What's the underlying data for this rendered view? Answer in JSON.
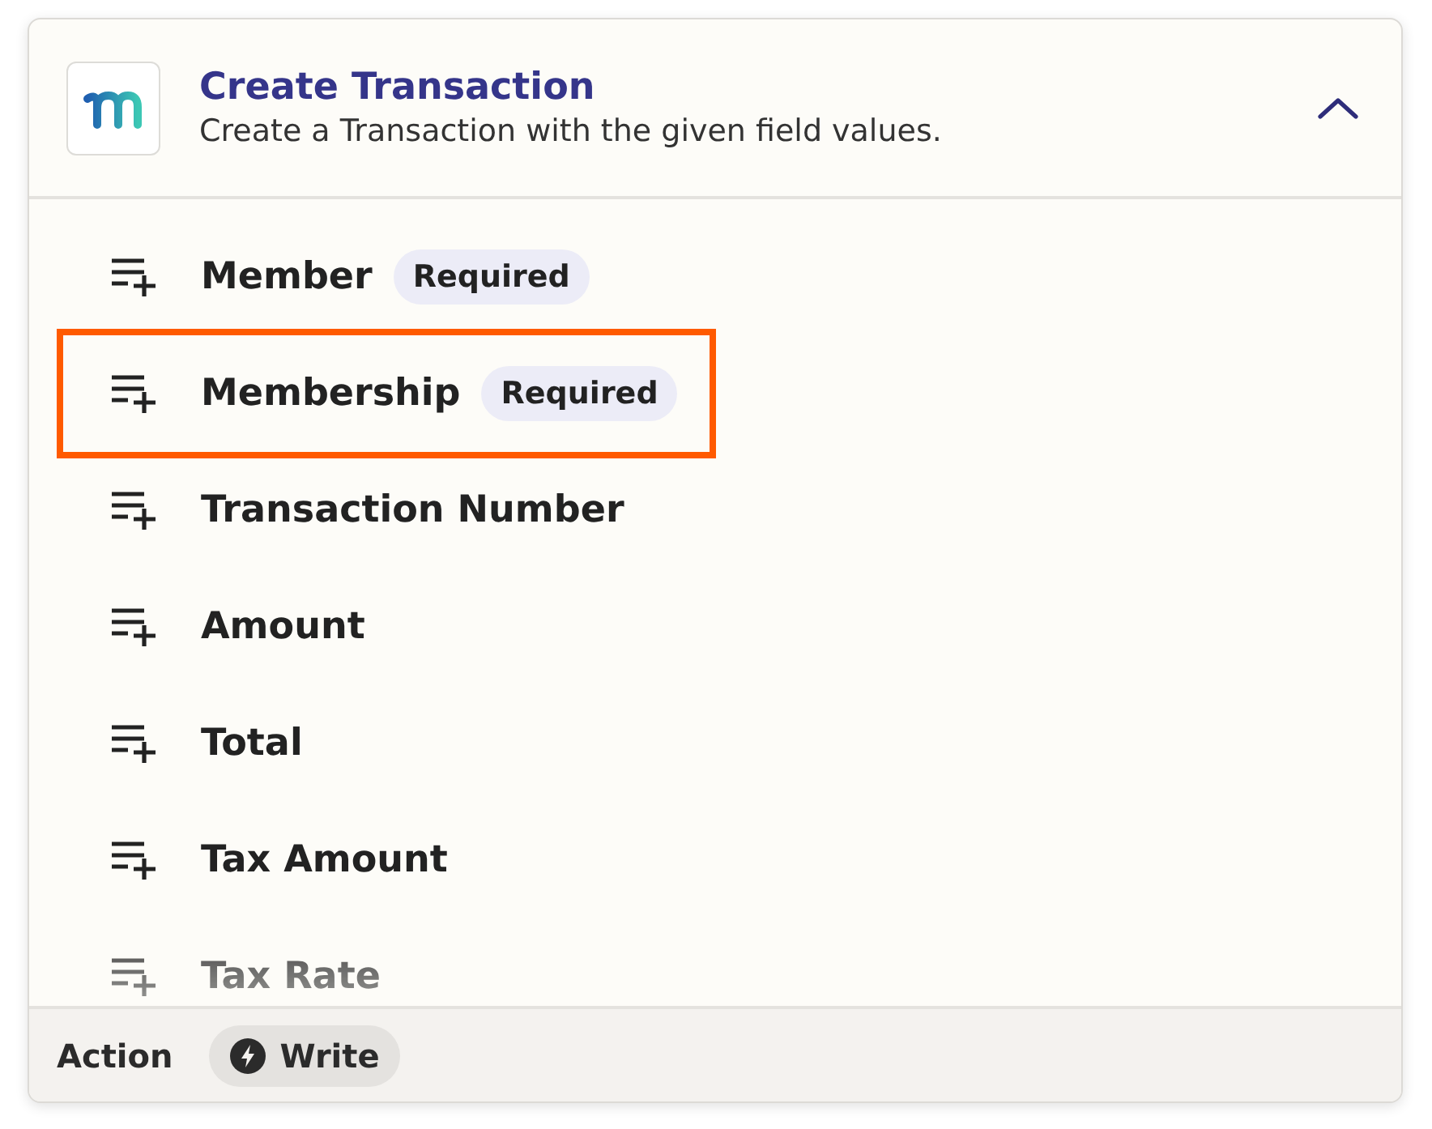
{
  "header": {
    "title": "Create Transaction",
    "description": "Create a Transaction with the given field values.",
    "expanded": true
  },
  "fields": [
    {
      "label": "Member",
      "required": true,
      "required_label": "Required",
      "highlighted": false
    },
    {
      "label": "Membership",
      "required": true,
      "required_label": "Required",
      "highlighted": true
    },
    {
      "label": "Transaction Number",
      "required": false,
      "highlighted": false
    },
    {
      "label": "Amount",
      "required": false,
      "highlighted": false
    },
    {
      "label": "Total",
      "required": false,
      "highlighted": false
    },
    {
      "label": "Tax Amount",
      "required": false,
      "highlighted": false
    },
    {
      "label": "Tax Rate",
      "required": false,
      "highlighted": false
    }
  ],
  "footer": {
    "label": "Action",
    "type": "Write"
  }
}
